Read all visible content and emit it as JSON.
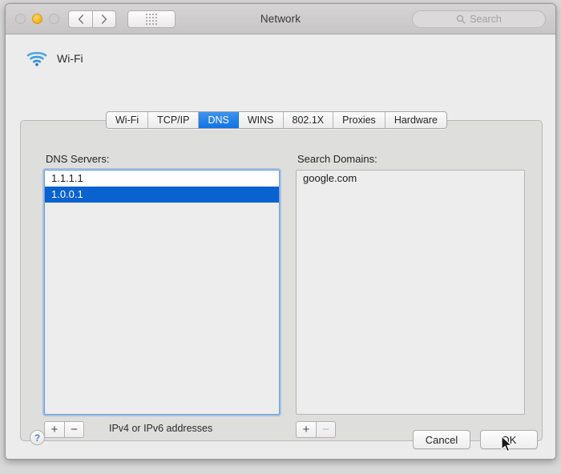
{
  "window": {
    "title": "Network",
    "traffic_lights": [
      {
        "name": "close",
        "color": "#cdcbcb",
        "enabled": false
      },
      {
        "name": "minimize",
        "color": "#f2b01e",
        "enabled": true
      },
      {
        "name": "zoom",
        "color": "#cdcbcb",
        "enabled": false
      }
    ],
    "nav": {
      "back_icon": "chevron-left-icon",
      "forward_icon": "chevron-right-icon"
    },
    "grid_button_icon": "grid-dots-icon",
    "search": {
      "placeholder": "Search",
      "value": "",
      "icon": "search-icon"
    }
  },
  "service": {
    "icon": "wifi-icon",
    "name": "Wi-Fi",
    "icon_color": "#3a9fe0"
  },
  "tabs": [
    {
      "label": "Wi-Fi",
      "active": false
    },
    {
      "label": "TCP/IP",
      "active": false
    },
    {
      "label": "DNS",
      "active": true
    },
    {
      "label": "WINS",
      "active": false
    },
    {
      "label": "802.1X",
      "active": false
    },
    {
      "label": "Proxies",
      "active": false
    },
    {
      "label": "Hardware",
      "active": false
    }
  ],
  "dns_panel": {
    "servers_label": "DNS Servers:",
    "servers": [
      {
        "value": "1.1.1.1",
        "selected": false
      },
      {
        "value": "1.0.0.1",
        "selected": true
      }
    ],
    "servers_hint": "IPv4 or IPv6 addresses",
    "add_label": "+",
    "remove_label": "−",
    "search_domains_label": "Search Domains:",
    "search_domains": [
      {
        "value": "google.com",
        "selected": false
      }
    ],
    "search_add_label": "+",
    "search_remove_label": "−"
  },
  "footer": {
    "help_label": "?",
    "cancel_label": "Cancel",
    "ok_label": "OK"
  },
  "colors": {
    "accent_blue": "#1272e4",
    "selection_blue": "#0a61d0",
    "focus_ring": "#6b9fd6",
    "window_bg": "#ececec",
    "panel_bg": "#dededd"
  }
}
